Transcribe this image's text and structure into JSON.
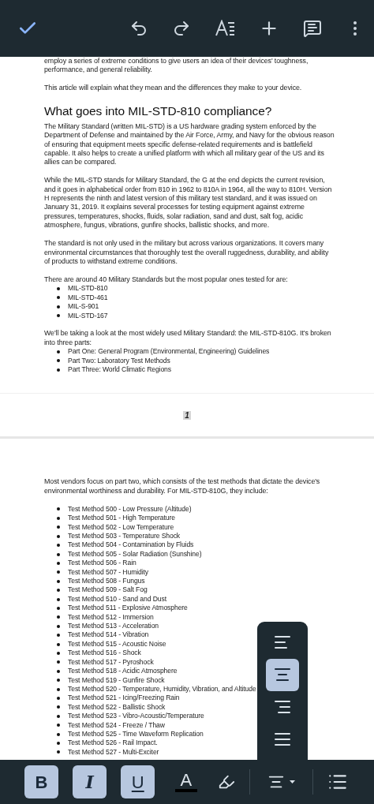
{
  "page_one": [
    {
      "kind": "paragraph",
      "text": "employ a series of extreme conditions to give users an idea of their devices' toughness, performance, and general reliability."
    },
    {
      "kind": "paragraph",
      "text": "This article will explain what they mean and the differences they make to your device."
    },
    {
      "kind": "heading",
      "text": "What goes into MIL-STD-810 compliance?"
    },
    {
      "kind": "paragraph",
      "text": "The Military Standard (written MIL-STD) is a US hardware grading system enforced by the Department of Defense and maintained by the Air Force, Army, and Navy for the obvious reason of ensuring that equipment meets specific defense-related requirements and is battlefield capable. It also helps to create a unified platform with which all military gear of the US and its allies can be compared."
    },
    {
      "kind": "paragraph",
      "text": "While the MIL-STD stands for Military Standard, the G at the end depicts the current revision, and it goes in alphabetical order from 810 in 1962 to 810A in 1964, all the way to 810H. Version H represents the ninth and latest version of this military test standard, and it was issued on January 31, 2019. It explains several processes for testing equipment against extreme pressures, temperatures, shocks, fluids, solar radiation, sand and dust, salt fog, acidic atmosphere, fungus, vibrations, gunfire shocks, ballistic shocks, and more."
    },
    {
      "kind": "paragraph",
      "text": "The standard is not only used in the military but across various organizations. It covers many environmental circumstances that thoroughly test the overall ruggedness, durability, and ability of products to withstand extreme conditions."
    },
    {
      "kind": "lead",
      "text": "There are around 40 Military Standards but the most popular ones tested for are:"
    },
    {
      "kind": "bullets",
      "items": [
        "MIL-STD-810",
        "MIL-STD-461",
        "MIL-S-901",
        "MIL-STD-167"
      ]
    },
    {
      "kind": "lead",
      "text": "We'll be taking a look at the most widely used Military Standard: the MIL-STD-810G. It's broken into three parts:"
    },
    {
      "kind": "bullets",
      "items": [
        "Part One: General Program (Environmental, Engineering) Guidelines",
        "Part Two: Laboratory Test Methods",
        "Part Three: World Climatic Regions"
      ]
    }
  ],
  "page_number": "1",
  "page_two": [
    {
      "kind": "paragraph",
      "text": "Most vendors focus on part two, which consists of the test methods that dictate the device's environmental worthiness and durability. For MIL-STD-810G, they include:"
    },
    {
      "kind": "bullets",
      "items": [
        "Test Method 500 - Low Pressure (Altitude)",
        "Test Method 501 - High Temperature",
        "Test Method 502 - Low Temperature",
        "Test Method 503 - Temperature Shock",
        "Test Method 504 - Contamination by Fluids",
        "Test Method 505 - Solar Radiation (Sunshine)",
        "Test Method 506 - Rain",
        "Test Method 507 - Humidity",
        "Test Method 508 - Fungus",
        "Test Method 509 - Salt Fog",
        "Test Method 510 - Sand and Dust",
        "Test Method 511 - Explosive Atmosphere",
        "Test Method 512 - Immersion",
        "Test Method 513 - Acceleration",
        "Test Method 514 - Vibration",
        "Test Method 515 - Acoustic Noise",
        "Test Method 516 - Shock",
        "Test Method 517 - Pyroshock",
        "Test Method 518 - Acidic Atmosphere",
        "Test Method 519 - Gunfire Shock",
        "Test Method 520 - Temperature, Humidity, Vibration, and Altitude",
        "Test Method 521 - Icing/Freezing Rain",
        "Test Method 522 - Ballistic Shock",
        "Test Method 523 - Vibro-Acoustic/Temperature",
        "Test Method 524 - Freeze / Thaw",
        "Test Method 525 - Time Waveform Replication",
        "Test Method 526 - Rail Impact.",
        "Test Method 527 - Multi-Exciter"
      ]
    }
  ],
  "alignment_menu": [
    {
      "kind": "left",
      "selected": false
    },
    {
      "kind": "center",
      "selected": true
    },
    {
      "kind": "right",
      "selected": false
    },
    {
      "kind": "justify",
      "selected": false
    }
  ],
  "format_bar": [
    {
      "kind": "bold",
      "text": "B",
      "selected": true
    },
    {
      "kind": "italic",
      "text": "I",
      "selected": true
    },
    {
      "kind": "underline",
      "text": "U",
      "selected": true
    },
    {
      "kind": "text_color",
      "text": "A",
      "color": "#000000"
    },
    {
      "kind": "highlight"
    },
    {
      "kind": "divider"
    },
    {
      "kind": "align"
    },
    {
      "kind": "divider"
    },
    {
      "kind": "list"
    }
  ]
}
